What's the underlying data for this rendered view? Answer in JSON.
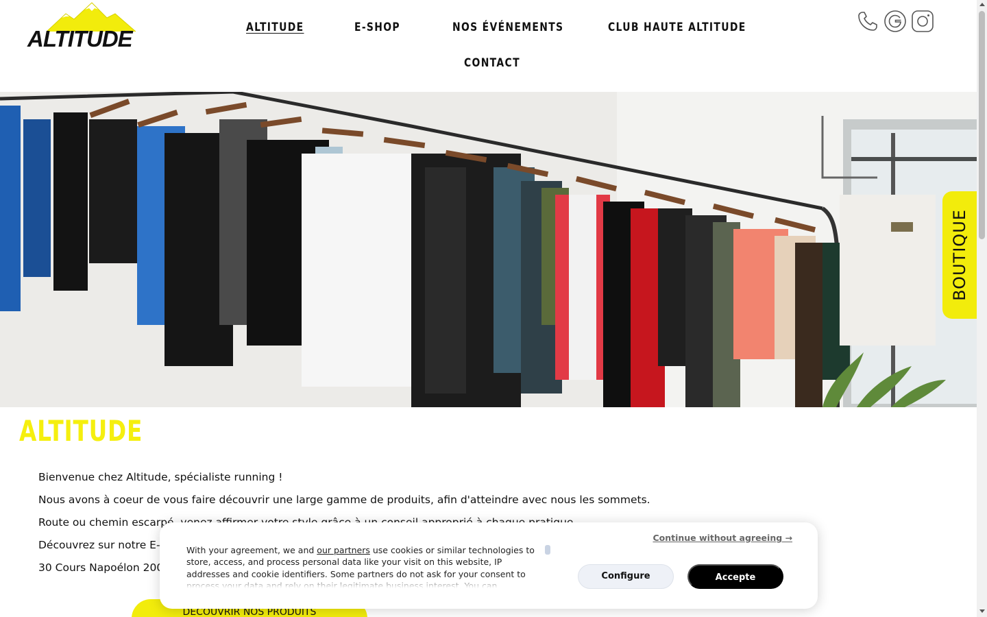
{
  "header": {
    "logo_text": "ALTITUDE",
    "nav": {
      "altitude": "ALTITUDE",
      "eshop": "E-SHOP",
      "events": "NOS ÉVÉNEMENTS",
      "club": "CLUB HAUTE ALTITUDE",
      "contact": "CONTACT"
    },
    "social_icons": [
      "phone-icon",
      "google-icon",
      "instagram-icon"
    ]
  },
  "hero": {
    "side_tab_label": "BOUTIQUE",
    "scroll_icon": "chevron-down-icon"
  },
  "main": {
    "title": "ALTITUDE",
    "paragraphs": [
      "Bienvenue chez Altitude, spécialiste running !",
      "Nous avons à coeur de vous faire découvrir une large gamme de produits, afin d'atteindre avec nous les sommets.",
      "Route ou chemin escarpé, venez affirmer votre style grâce à un conseil approprié à chaque pratique.",
      "Découvrez sur notre E-s",
      "30 Cours Napoélon 200"
    ],
    "cta_label": "DECOUVRIR NOS PRODUITS"
  },
  "cookie_banner": {
    "text_before_link": "With your agreement, we and ",
    "link_text": "our partners",
    "text_after_link": " use cookies or similar technologies to store, access, and process personal data like your visit on this website, IP addresses and cookie identifiers. Some partners do not ask for your consent to process your data and rely on their legitimate business interest. You can",
    "continue_label": "Continue without agreeing →",
    "configure_label": "Configure",
    "accept_label": "Accepte"
  },
  "colors": {
    "brand_yellow": "#f2ec0c",
    "title_yellow": "#f5ef0e",
    "text_dark": "#111111",
    "accept_bg": "#000000"
  }
}
